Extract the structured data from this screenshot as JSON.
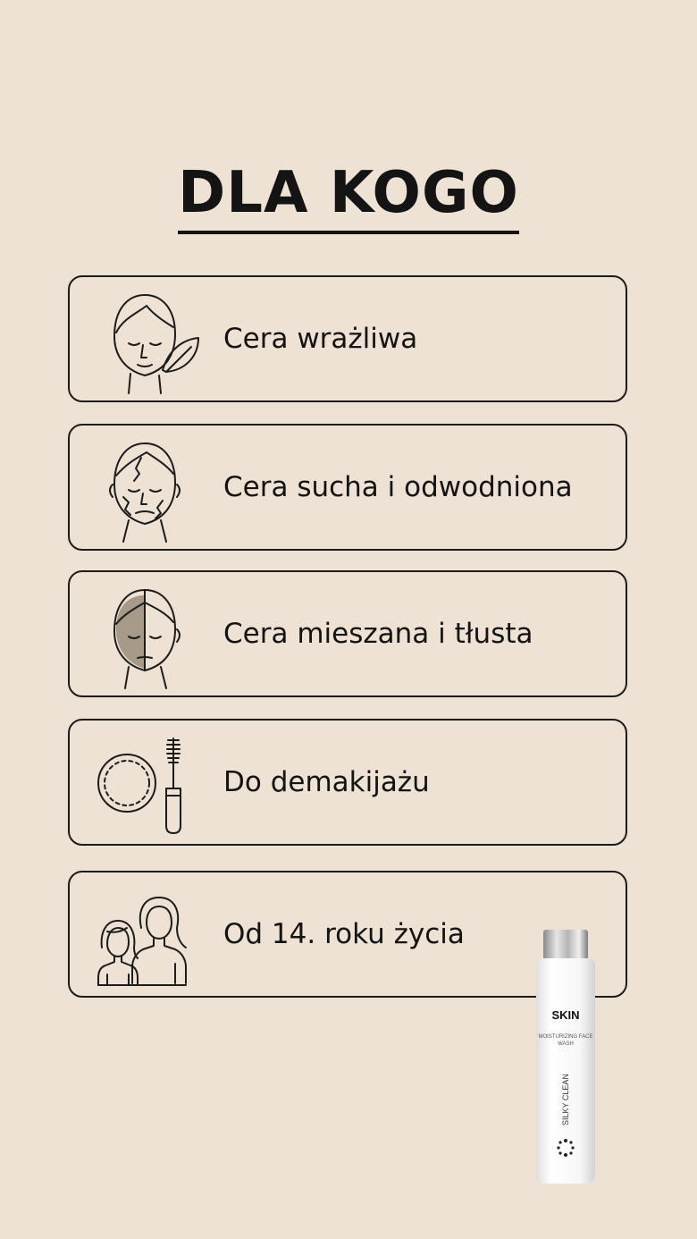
{
  "title": "DLA KOGO",
  "items": [
    {
      "label": "Cera wrażliwa",
      "icon": "face-with-leaf-icon"
    },
    {
      "label": "Cera sucha i odwodniona",
      "icon": "cracked-face-icon"
    },
    {
      "label": "Cera mieszana i tłusta",
      "icon": "half-shaded-face-icon"
    },
    {
      "label": "Do demakijażu",
      "icon": "cotton-pad-and-mascara-icon"
    },
    {
      "label": "Od 14. roku życia",
      "icon": "girl-and-woman-icon"
    }
  ],
  "product": {
    "brand": "SKIN",
    "type": "MOISTURIZING FACE WASH",
    "name": "SILKY CLEAN"
  },
  "colors": {
    "background": "#ede2d3",
    "ink": "#141414",
    "shade": "#a89a88"
  }
}
